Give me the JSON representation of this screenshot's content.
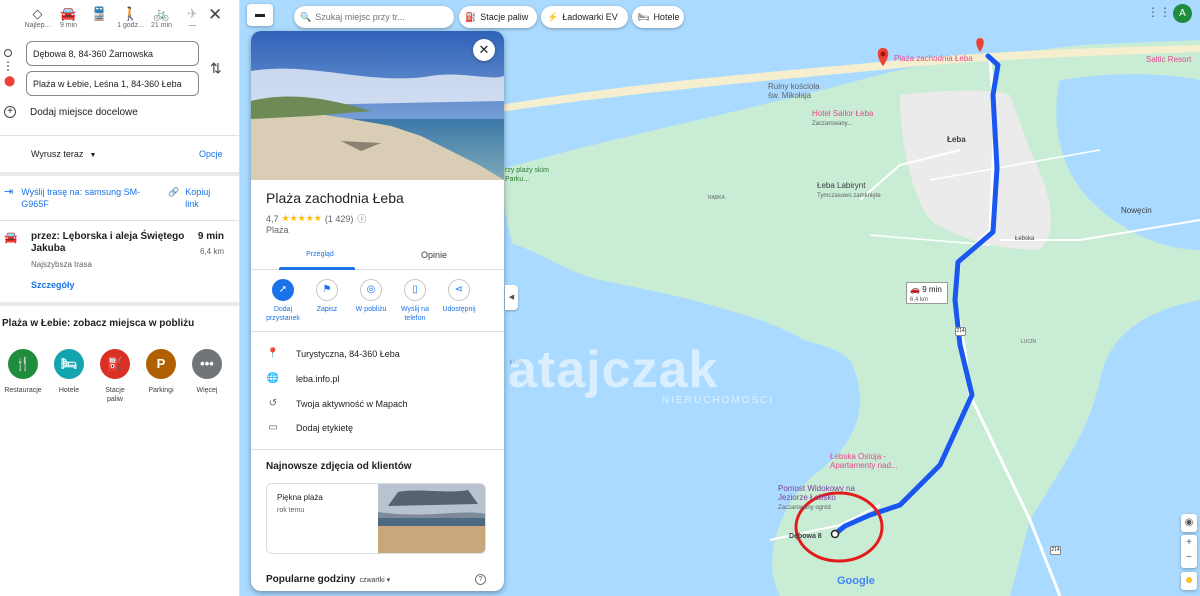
{
  "directions": {
    "modes": [
      {
        "label": "Najlep...",
        "icon": "best-route-icon"
      },
      {
        "label": "9 min",
        "icon": "car-icon"
      },
      {
        "label": "",
        "icon": "transit-icon"
      },
      {
        "label": "1 godz...",
        "icon": "walk-icon"
      },
      {
        "label": "21 min",
        "icon": "bike-icon"
      },
      {
        "label": "—",
        "icon": "flight-icon"
      }
    ],
    "origin": "Dębowa 8, 84-360 Żarnowska",
    "destination": "Plaża w Łebie, Leśna 1, 84-360 Łeba",
    "add_destination": "Dodaj miejsce docelowe",
    "depart": "Wyrusz teraz",
    "options": "Opcje",
    "send_to_phone": "Wyślij trasę na: samsung SM-G965F",
    "copy_link": "Kopiuj link",
    "route": {
      "via": "przez: Lęborska i aleja Świętego Jakuba",
      "time": "9 min",
      "distance": "6,4 km",
      "note": "Najszybsza trasa",
      "details": "Szczegóły"
    },
    "nearby_title": "Plaża w Łebie: zobacz miejsca w pobliżu",
    "categories": [
      {
        "label": "Restauracje",
        "color": "#1e8e3e",
        "icon": "restaurant-icon"
      },
      {
        "label": "Hotele",
        "color": "#12a4af",
        "icon": "hotel-icon"
      },
      {
        "label": "Stacje paliw",
        "color": "#d93025",
        "icon": "gas-station-icon"
      },
      {
        "label": "Parkingi",
        "color": "#b06000",
        "icon": "parking-icon"
      },
      {
        "label": "Więcej",
        "color": "#70757a",
        "icon": "more-icon"
      }
    ]
  },
  "topbar": {
    "search_placeholder": "Szukaj miejsc przy tr...",
    "chips": [
      "Stacje paliw",
      "Ładowarki EV",
      "Hotele"
    ]
  },
  "place": {
    "title": "Plaża zachodnia Łeba",
    "rating": "4,7",
    "stars": "★★★★★",
    "reviews": "(1 429)",
    "type": "Plaża",
    "tabs": [
      "Przegląd",
      "Opinie"
    ],
    "actions": [
      {
        "label": "Dodaj przystanek",
        "icon": "add-stop-icon"
      },
      {
        "label": "Zapisz",
        "icon": "bookmark-icon"
      },
      {
        "label": "W pobliżu",
        "icon": "nearby-icon"
      },
      {
        "label": "Wyślij na telefon",
        "icon": "phone-icon"
      },
      {
        "label": "Udostępnij",
        "icon": "share-icon"
      }
    ],
    "address": "Turystyczna, 84-360 Łeba",
    "website": "leba.info.pl",
    "activity": "Twoja aktywność w Mapach",
    "label": "Dodaj etykietę",
    "photos_title": "Najnowsze zdjęcia od klientów",
    "photo_card": {
      "title": "Piękna plaża",
      "date": "rok temu"
    },
    "popular_times": "Popularne godziny",
    "popular_day": "czwartki"
  },
  "map": {
    "labels": {
      "beach": "Plaża zachodnia Łeba",
      "ruins": "Ruiny kościoła św. Mikołaja",
      "hotel": "Hotel Sailor Łeba",
      "hotel_sub": "Zaczarowany...",
      "leba": "Łeba",
      "labirynt": "Łeba Labirynt",
      "labirynt_sub": "Tymczasowo zamknięte",
      "nowecin": "Nowęcin",
      "lebska": "Łebska",
      "ostoja": "Łebska Ostoja - Apartamenty nad...",
      "pomost": "Pomost Widokowy na Jeziorze Łebsko",
      "pomost_sub": "Zaczarowany ogród",
      "saltic": "Saltic Resort",
      "dunes": "rzy plaży skim Parku...",
      "rabka": "RĄBKA",
      "lucin": "LUCIN",
      "lake": "Łeba",
      "debowa": "Dębowa 8"
    },
    "route_time": "9 min",
    "route_dist": "6,4 km",
    "road_num": "214",
    "watermark": "atajczak",
    "watermark_sub": "NIERUCHOMOŚCI",
    "google": "Google",
    "avatar": "A",
    "colors": {
      "water": "#aadaff",
      "land": "#c8ecd4",
      "route": "#1a56f0",
      "circle": "#e31b1b"
    }
  }
}
